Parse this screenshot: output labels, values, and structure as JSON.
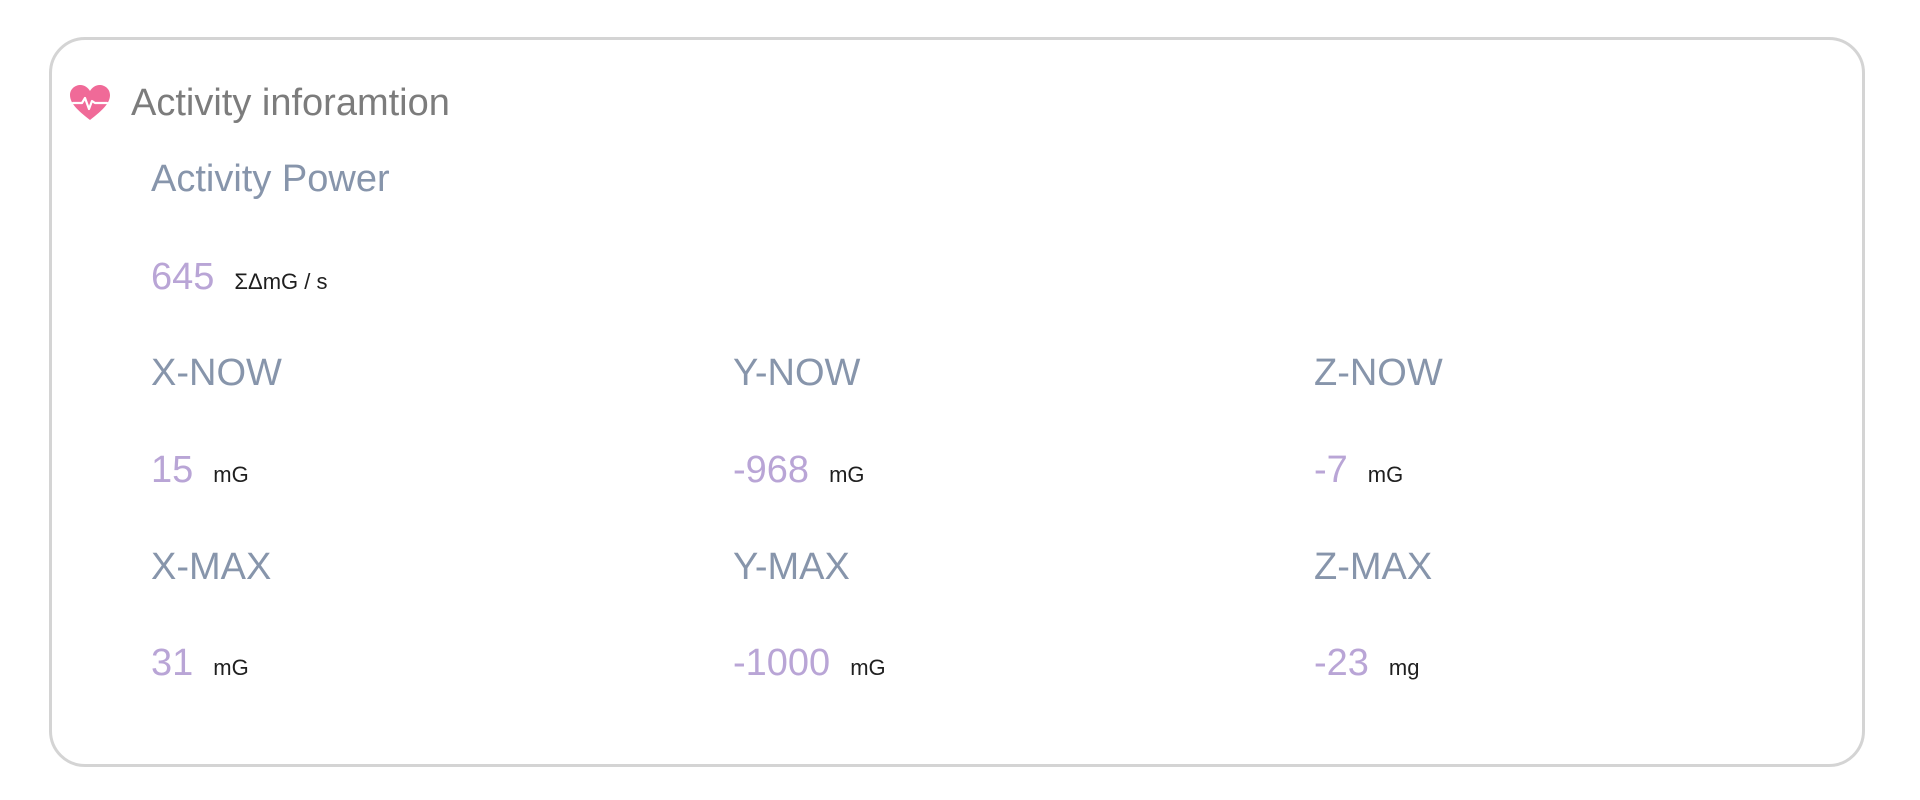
{
  "card": {
    "title": "Activity inforamtion",
    "icon": "heart-pulse-icon",
    "accent_color": "#f06a98"
  },
  "activity_power": {
    "label": "Activity Power",
    "value": "645",
    "unit": "ΣΔmG / s"
  },
  "axes": {
    "x_now": {
      "label": "X-NOW",
      "value": "15",
      "unit": "mG"
    },
    "y_now": {
      "label": "Y-NOW",
      "value": "-968",
      "unit": "mG"
    },
    "z_now": {
      "label": "Z-NOW",
      "value": "-7",
      "unit": "mG"
    },
    "x_max": {
      "label": "X-MAX",
      "value": "31",
      "unit": "mG"
    },
    "y_max": {
      "label": "Y-MAX",
      "value": "-1000",
      "unit": "mG"
    },
    "z_max": {
      "label": "Z-MAX",
      "value": "-23",
      "unit": "mg"
    }
  },
  "colors": {
    "label": "#8795ab",
    "value": "#b9a5d6",
    "unit": "#1f1f1f",
    "title": "#7c7c7c",
    "border": "#d4d4d4"
  }
}
